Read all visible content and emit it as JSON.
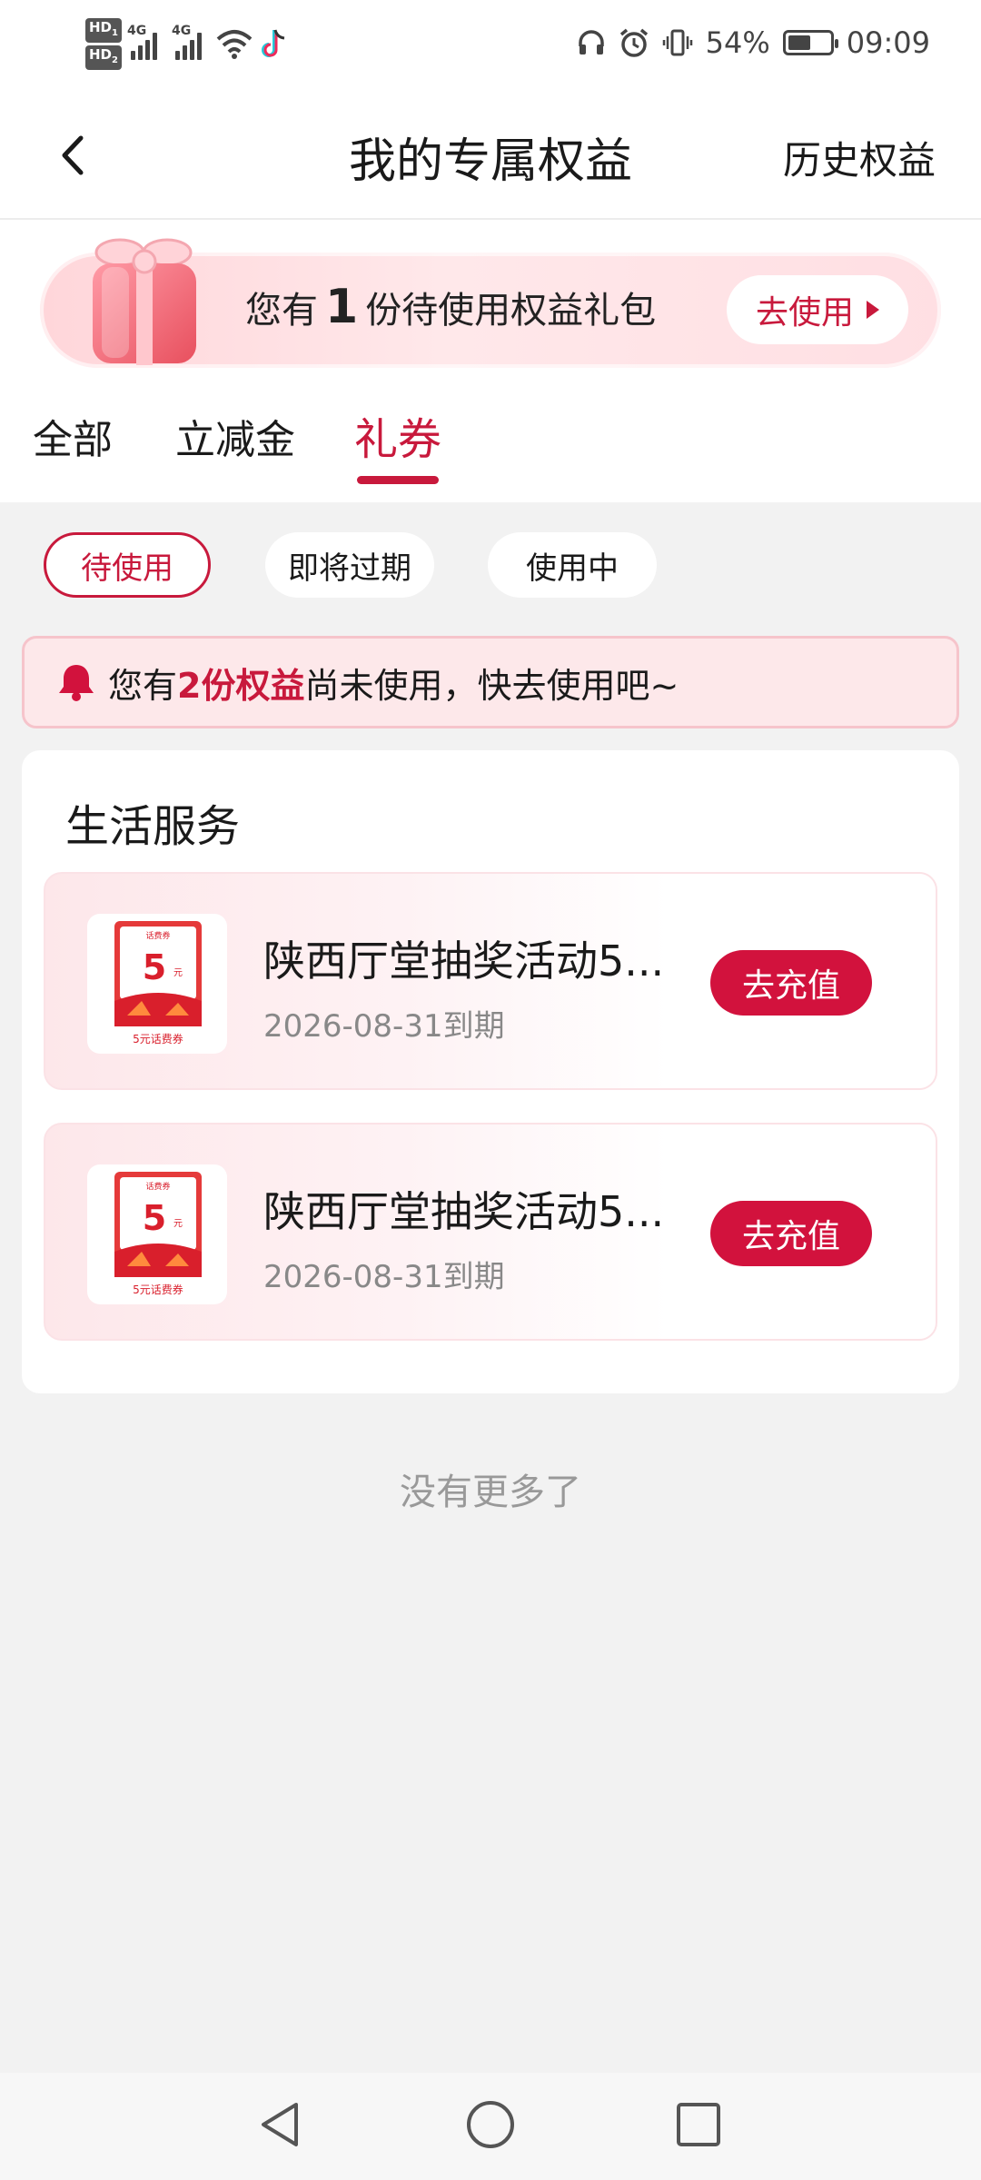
{
  "status_bar": {
    "hd1": "HD",
    "hd1_sub": "1",
    "hd2": "HD",
    "hd2_sub": "2",
    "net1": "4G",
    "net2": "4G",
    "battery_percent": "54%",
    "battery_level": 0.54,
    "time": "09:09"
  },
  "header": {
    "title": "我的专属权益",
    "history_link": "历史权益"
  },
  "banner": {
    "prefix": "您有",
    "count": "1",
    "suffix": "份待使用权益礼包",
    "button": "去使用"
  },
  "tabs": [
    {
      "label": "全部",
      "active": false
    },
    {
      "label": "立减金",
      "active": false
    },
    {
      "label": "礼券",
      "active": true
    }
  ],
  "filters": [
    {
      "label": "待使用",
      "active": true
    },
    {
      "label": "即将过期",
      "active": false
    },
    {
      "label": "使用中",
      "active": false
    }
  ],
  "notice": {
    "prefix": "您有",
    "highlight": "2份权益",
    "suffix": "尚未使用，快去使用吧~"
  },
  "section": {
    "title": "生活服务",
    "coupons": [
      {
        "name": "陕西厅堂抽奖活动5...",
        "expiry": "2026-08-31到期",
        "button": "去充值",
        "thumb_top": "话费券",
        "thumb_value": "5",
        "thumb_unit": "元",
        "thumb_caption": "5元话费券"
      },
      {
        "name": "陕西厅堂抽奖活动5...",
        "expiry": "2026-08-31到期",
        "button": "去充值",
        "thumb_top": "话费券",
        "thumb_value": "5",
        "thumb_unit": "元",
        "thumb_caption": "5元话费券"
      }
    ]
  },
  "footer_text": "没有更多了",
  "colors": {
    "accent": "#c8193c",
    "button_red": "#d2123d",
    "background": "#f2f2f2"
  },
  "icons": {
    "back": "chevron-left-icon",
    "bell": "bell-icon",
    "gift": "gift-icon",
    "nav_back": "triangle-back-icon",
    "nav_home": "circle-home-icon",
    "nav_recent": "square-recent-icon"
  }
}
